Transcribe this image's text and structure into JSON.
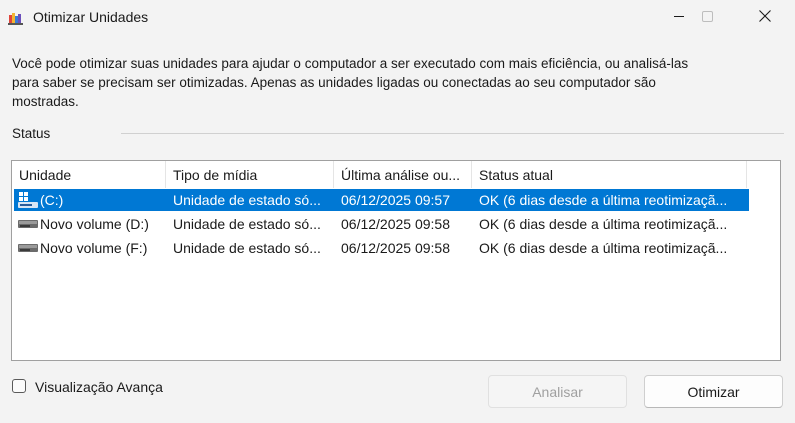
{
  "window": {
    "title": "Otimizar Unidades",
    "controls": {
      "minimize_icon": "minimize-icon",
      "maximize_icon": "maximize-icon",
      "close_icon": "close-icon"
    }
  },
  "description": "Você pode otimizar suas unidades para ajudar o computador a ser executado com mais eficiência, ou analisá-las para saber se precisam ser otimizadas. Apenas as unidades ligadas ou conectadas ao seu computador são mostradas.",
  "status_section": {
    "label": "Status"
  },
  "table": {
    "columns": [
      "Unidade",
      "Tipo de mídia",
      "Última análise ou...",
      "Status atual"
    ],
    "rows": [
      {
        "drive": "(C:)",
        "media_type": "Unidade de estado só...",
        "last_analysis": "06/12/2025 09:57",
        "status": "OK (6 dias desde a última reotimizaçã...",
        "selected": true,
        "icon": "system-drive-icon"
      },
      {
        "drive": "Novo volume (D:)",
        "media_type": "Unidade de estado só...",
        "last_analysis": "06/12/2025 09:58",
        "status": "OK (6 dias desde a última reotimizaçã...",
        "selected": false,
        "icon": "drive-icon"
      },
      {
        "drive": "Novo volume (F:)",
        "media_type": "Unidade de estado só...",
        "last_analysis": "06/12/2025 09:58",
        "status": "OK (6 dias desde a última reotimizaçã...",
        "selected": false,
        "icon": "drive-icon"
      }
    ]
  },
  "advanced_view": {
    "label": "Visualização Avança",
    "checked": false
  },
  "buttons": {
    "analyze": "Analisar",
    "optimize": "Otimizar"
  },
  "colors": {
    "selection": "#0078d4",
    "background": "#f3f3f3"
  }
}
